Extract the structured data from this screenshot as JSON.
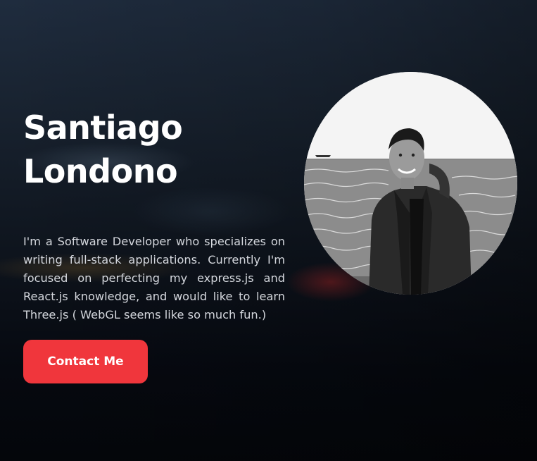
{
  "hero": {
    "name_line1": "Santiago",
    "name_line2": "Londono",
    "bio": "I'm a Software Developer who specializes on writing full-stack applications. Currently I'm focused on perfecting my express.js and React.js knowledge, and would like to learn Three.js ( WebGL seems like so much fun.)",
    "contact_label": "Contact Me"
  },
  "avatar": {
    "icon": "profile-photo"
  },
  "colors": {
    "accent": "#f0363c",
    "text": "#ffffff",
    "body_text": "#d4d7dd",
    "background": "#070a10"
  }
}
